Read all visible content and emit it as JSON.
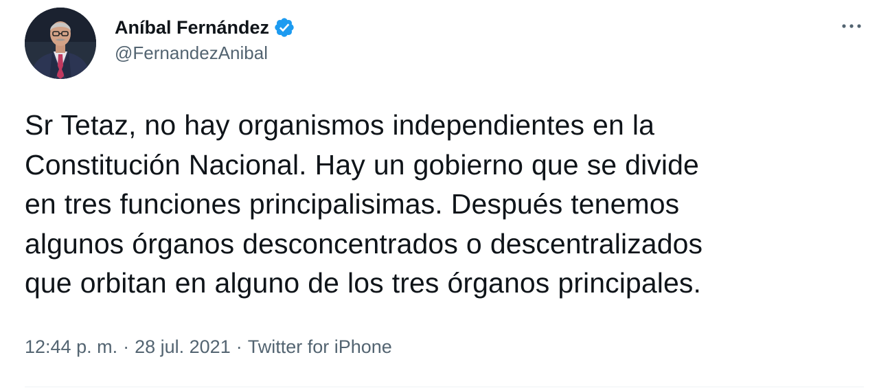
{
  "tweet": {
    "author": {
      "display_name": "Aníbal Fernández",
      "handle": "@FernandezAnibal",
      "verified": true,
      "avatar_icon": "profile-photo"
    },
    "more_icon": "more-options-icon",
    "text_lines": [
      "Sr Tetaz, no hay organismos independientes en la",
      "Constitución Nacional. Hay un gobierno que se divide",
      "en tres funciones principalisimas. Después tenemos",
      "algunos órganos desconcentrados o descentralizados",
      "que orbitan en alguno de los tres órganos principales."
    ],
    "meta": {
      "time": "12:44 p. m.",
      "separator": "·",
      "date": "28 jul. 2021",
      "source": "Twitter for iPhone"
    }
  },
  "colors": {
    "text": "#0f1419",
    "secondary": "#536471",
    "verified_badge": "#1d9bf0",
    "divider": "#eff3f4"
  }
}
